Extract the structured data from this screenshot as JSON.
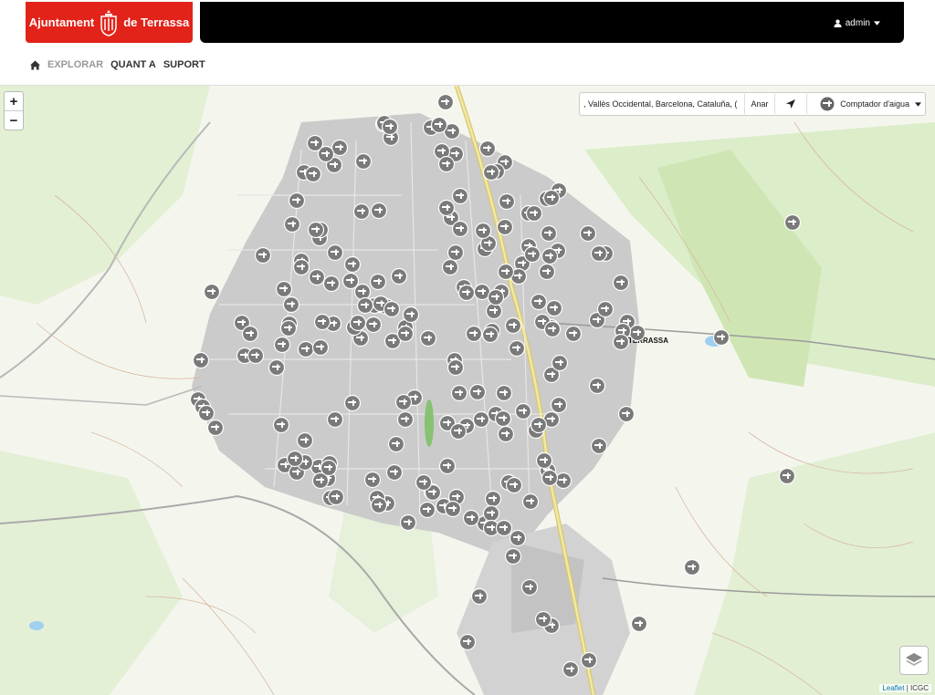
{
  "header": {
    "logo_left": "Ajuntament",
    "logo_right": "de Terrassa",
    "user": "admin"
  },
  "nav": {
    "items": [
      "EXPLORAR",
      "QUANT A",
      "SUPORT"
    ]
  },
  "map": {
    "search_value": ", Vallès Occidental, Barcelona, Cataluña, (",
    "go_label": "Anar",
    "layer_label": "Comptador d'aigua",
    "place_label": "TERRASSA",
    "attribution_link": "Leaflet",
    "attribution_text": "| ICGC",
    "marker_count": 256,
    "marker_icon": "water-meter-icon"
  },
  "colors": {
    "brand_red": "#e2231a",
    "topbar": "#000000",
    "marker": "#7a7a7a",
    "urban": "#c8c8c8",
    "green": "#dff0cf"
  }
}
